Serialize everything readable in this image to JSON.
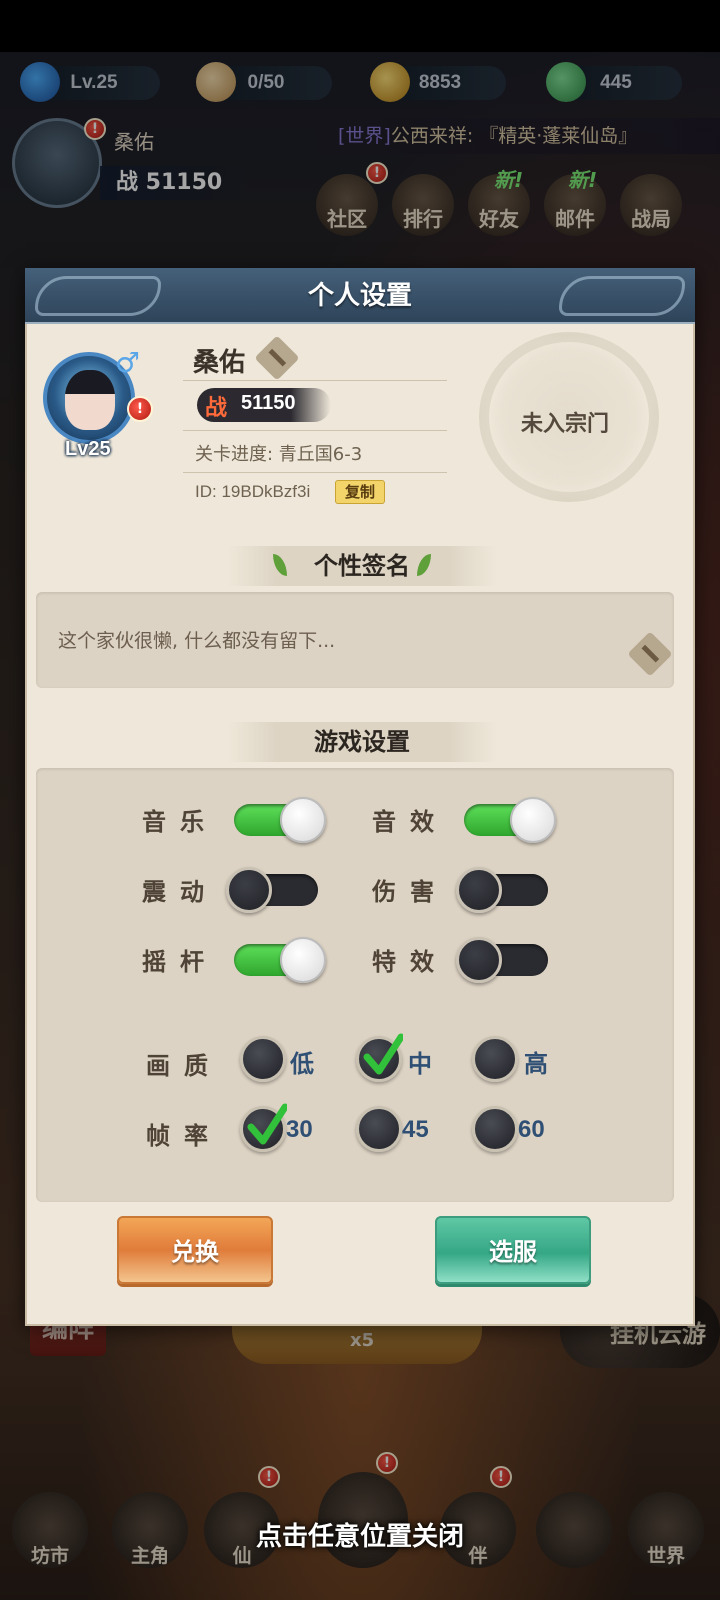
{
  "background": {
    "resources": [
      {
        "icon": "level-icon",
        "value": "Lv.25"
      },
      {
        "icon": "bun-icon",
        "value": "0/50"
      },
      {
        "icon": "coin-icon",
        "value": "8853"
      },
      {
        "icon": "gem-icon",
        "value": "445"
      }
    ],
    "player_name": "桑佑",
    "player_power": "战 51150",
    "news_tag": "[世界]",
    "news_text": "公西来祥: 『精英·蓬莱仙岛』",
    "menu": [
      "社区",
      "排行",
      "好友",
      "邮件",
      "战局"
    ],
    "new_tag": "新!",
    "formation_label": "编阵",
    "hang_label": "挂机云游",
    "multiplier": "x5",
    "bottom_nav": [
      "坊市",
      "主角",
      "仙",
      "",
      "伴",
      "",
      "世界"
    ],
    "close_hint": "点击任意位置关闭"
  },
  "panel": {
    "title": "个人设置",
    "profile": {
      "name": "桑佑",
      "level": "Lv25",
      "gender_symbol": "♂",
      "power_icon": "战",
      "power": "51150",
      "stage": "关卡进度: 青丘国6-3",
      "id": "ID: 19BDkBzf3i",
      "copy_label": "复制",
      "sect": "未入宗门"
    },
    "signature": {
      "header": "个性签名",
      "text": "这个家伙很懒, 什么都没有留下..."
    },
    "game_settings": {
      "header": "游戏设置",
      "toggles": [
        {
          "label": "音乐",
          "on": true
        },
        {
          "label": "音效",
          "on": true
        },
        {
          "label": "震动",
          "on": false
        },
        {
          "label": "伤害",
          "on": false
        },
        {
          "label": "摇杆",
          "on": true
        },
        {
          "label": "特效",
          "on": false
        }
      ],
      "quality": {
        "label": "画质",
        "options": [
          "低",
          "中",
          "高"
        ],
        "selected": "中"
      },
      "framerate": {
        "label": "帧率",
        "options": [
          "30",
          "45",
          "60"
        ],
        "selected": "30"
      }
    },
    "buttons": {
      "exchange": "兑换",
      "select_server": "选服"
    }
  }
}
